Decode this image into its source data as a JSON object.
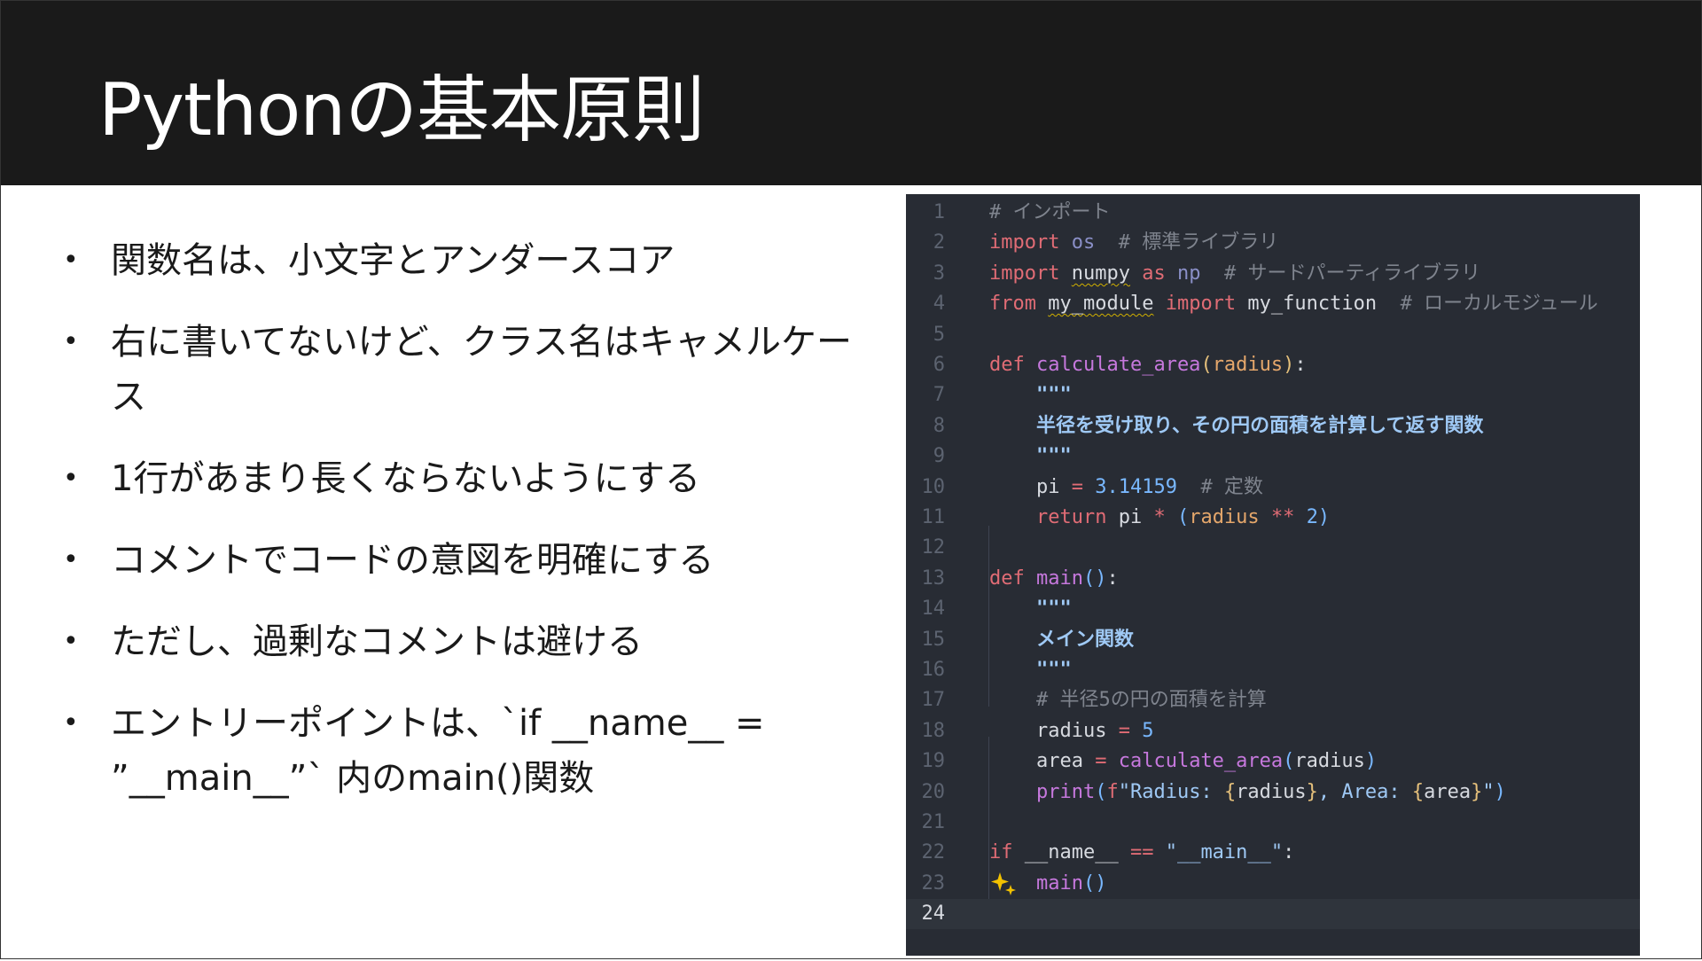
{
  "slide": {
    "title": "Pythonの基本原則"
  },
  "bullets": [
    {
      "text": "関数名は、小文字とアンダースコア"
    },
    {
      "text": "右に書いてないけど、クラス名はキャメルケース"
    },
    {
      "text": "1行があまり長くならないようにする"
    },
    {
      "text": "コメントでコードの意図を明確にする"
    },
    {
      "text": "ただし、過剰なコメントは避ける"
    },
    {
      "text": "エントリーポイントは、`if __name__ = ”__main__”` 内のmain()関数"
    }
  ],
  "bullet_marker": "•",
  "code": {
    "current_line": 24,
    "lines": [
      {
        "n": "1",
        "tokens": [
          [
            "cm",
            "# インポート"
          ]
        ]
      },
      {
        "n": "2",
        "tokens": [
          [
            "kw",
            "import"
          ],
          [
            "pl",
            " "
          ],
          [
            "mod",
            "os"
          ],
          [
            "pl",
            "  "
          ],
          [
            "cm",
            "# 標準ライブラリ"
          ]
        ]
      },
      {
        "n": "3",
        "tokens": [
          [
            "kw",
            "import"
          ],
          [
            "pl",
            " "
          ],
          [
            "sq",
            "numpy"
          ],
          [
            "pl",
            " "
          ],
          [
            "kw",
            "as"
          ],
          [
            "pl",
            " "
          ],
          [
            "mod",
            "np"
          ],
          [
            "pl",
            "  "
          ],
          [
            "cm",
            "# サードパーティライブラリ"
          ]
        ]
      },
      {
        "n": "4",
        "tokens": [
          [
            "kw",
            "from"
          ],
          [
            "pl",
            " "
          ],
          [
            "sq",
            "my_module"
          ],
          [
            "pl",
            " "
          ],
          [
            "kw",
            "import"
          ],
          [
            "pl",
            " my_function  "
          ],
          [
            "cm",
            "# ローカルモジュール"
          ]
        ]
      },
      {
        "n": "5",
        "tokens": []
      },
      {
        "n": "6",
        "tokens": [
          [
            "kw",
            "def"
          ],
          [
            "pl",
            " "
          ],
          [
            "fn",
            "calculate_area"
          ],
          [
            "br",
            "("
          ],
          [
            "par",
            "radius"
          ],
          [
            "br",
            ")"
          ],
          [
            "pl",
            ":"
          ]
        ]
      },
      {
        "n": "7",
        "tokens": [
          [
            "pl",
            "    "
          ],
          [
            "doc",
            "\"\"\""
          ]
        ]
      },
      {
        "n": "8",
        "tokens": [
          [
            "pl",
            "    "
          ],
          [
            "doc",
            "半径を受け取り、その円の面積を計算して返す関数"
          ]
        ]
      },
      {
        "n": "9",
        "tokens": [
          [
            "pl",
            "    "
          ],
          [
            "doc",
            "\"\"\""
          ]
        ]
      },
      {
        "n": "10",
        "tokens": [
          [
            "pl",
            "    pi "
          ],
          [
            "op",
            "="
          ],
          [
            "pl",
            " "
          ],
          [
            "num",
            "3.14159"
          ],
          [
            "pl",
            "  "
          ],
          [
            "cm",
            "# 定数"
          ]
        ]
      },
      {
        "n": "11",
        "tokens": [
          [
            "pl",
            "    "
          ],
          [
            "kw",
            "return"
          ],
          [
            "pl",
            " pi "
          ],
          [
            "op",
            "*"
          ],
          [
            "pl",
            " "
          ],
          [
            "num",
            "("
          ],
          [
            "par",
            "radius"
          ],
          [
            "pl",
            " "
          ],
          [
            "op",
            "**"
          ],
          [
            "pl",
            " "
          ],
          [
            "num",
            "2)"
          ]
        ]
      },
      {
        "n": "12",
        "tokens": []
      },
      {
        "n": "13",
        "tokens": [
          [
            "kw",
            "def"
          ],
          [
            "pl",
            " "
          ],
          [
            "fn",
            "main"
          ],
          [
            "num",
            "()"
          ],
          [
            "pl",
            ":"
          ]
        ]
      },
      {
        "n": "14",
        "tokens": [
          [
            "pl",
            "    "
          ],
          [
            "doc",
            "\"\"\""
          ]
        ]
      },
      {
        "n": "15",
        "tokens": [
          [
            "pl",
            "    "
          ],
          [
            "doc",
            "メイン関数"
          ]
        ]
      },
      {
        "n": "16",
        "tokens": [
          [
            "pl",
            "    "
          ],
          [
            "doc",
            "\"\"\""
          ]
        ]
      },
      {
        "n": "17",
        "tokens": [
          [
            "pl",
            "    "
          ],
          [
            "cm",
            "# 半径5の円の面積を計算"
          ]
        ]
      },
      {
        "n": "18",
        "tokens": [
          [
            "pl",
            "    radius "
          ],
          [
            "op",
            "="
          ],
          [
            "pl",
            " "
          ],
          [
            "num",
            "5"
          ]
        ]
      },
      {
        "n": "19",
        "tokens": [
          [
            "pl",
            "    area "
          ],
          [
            "op",
            "="
          ],
          [
            "pl",
            " "
          ],
          [
            "fn",
            "calculate_area"
          ],
          [
            "num",
            "("
          ],
          [
            "pl",
            "radius"
          ],
          [
            "num",
            ")"
          ]
        ]
      },
      {
        "n": "20",
        "tokens": [
          [
            "pl",
            "    "
          ],
          [
            "fn",
            "print"
          ],
          [
            "num",
            "("
          ],
          [
            "kw",
            "f"
          ],
          [
            "str",
            "\"Radius: "
          ],
          [
            "br",
            "{"
          ],
          [
            "pl",
            "radius"
          ],
          [
            "br",
            "}"
          ],
          [
            "str",
            ", Area: "
          ],
          [
            "br",
            "{"
          ],
          [
            "pl",
            "area"
          ],
          [
            "br",
            "}"
          ],
          [
            "str",
            "\""
          ],
          [
            "num",
            ")"
          ]
        ]
      },
      {
        "n": "21",
        "tokens": []
      },
      {
        "n": "22",
        "tokens": [
          [
            "kw",
            "if"
          ],
          [
            "pl",
            " __name__ "
          ],
          [
            "op",
            "=="
          ],
          [
            "pl",
            " "
          ],
          [
            "str",
            "\"__main__\""
          ],
          [
            "pl",
            ":"
          ]
        ]
      },
      {
        "n": "23",
        "tokens": [
          [
            "pl",
            "    "
          ],
          [
            "fn",
            "main"
          ],
          [
            "num",
            "()"
          ]
        ]
      },
      {
        "n": "24",
        "tokens": []
      }
    ]
  },
  "icons": {
    "sparkle": "sparkle-icon"
  },
  "colors": {
    "header_bg": "#1a1a1a",
    "code_bg": "#282c34",
    "sparkle": "#f2c100"
  }
}
